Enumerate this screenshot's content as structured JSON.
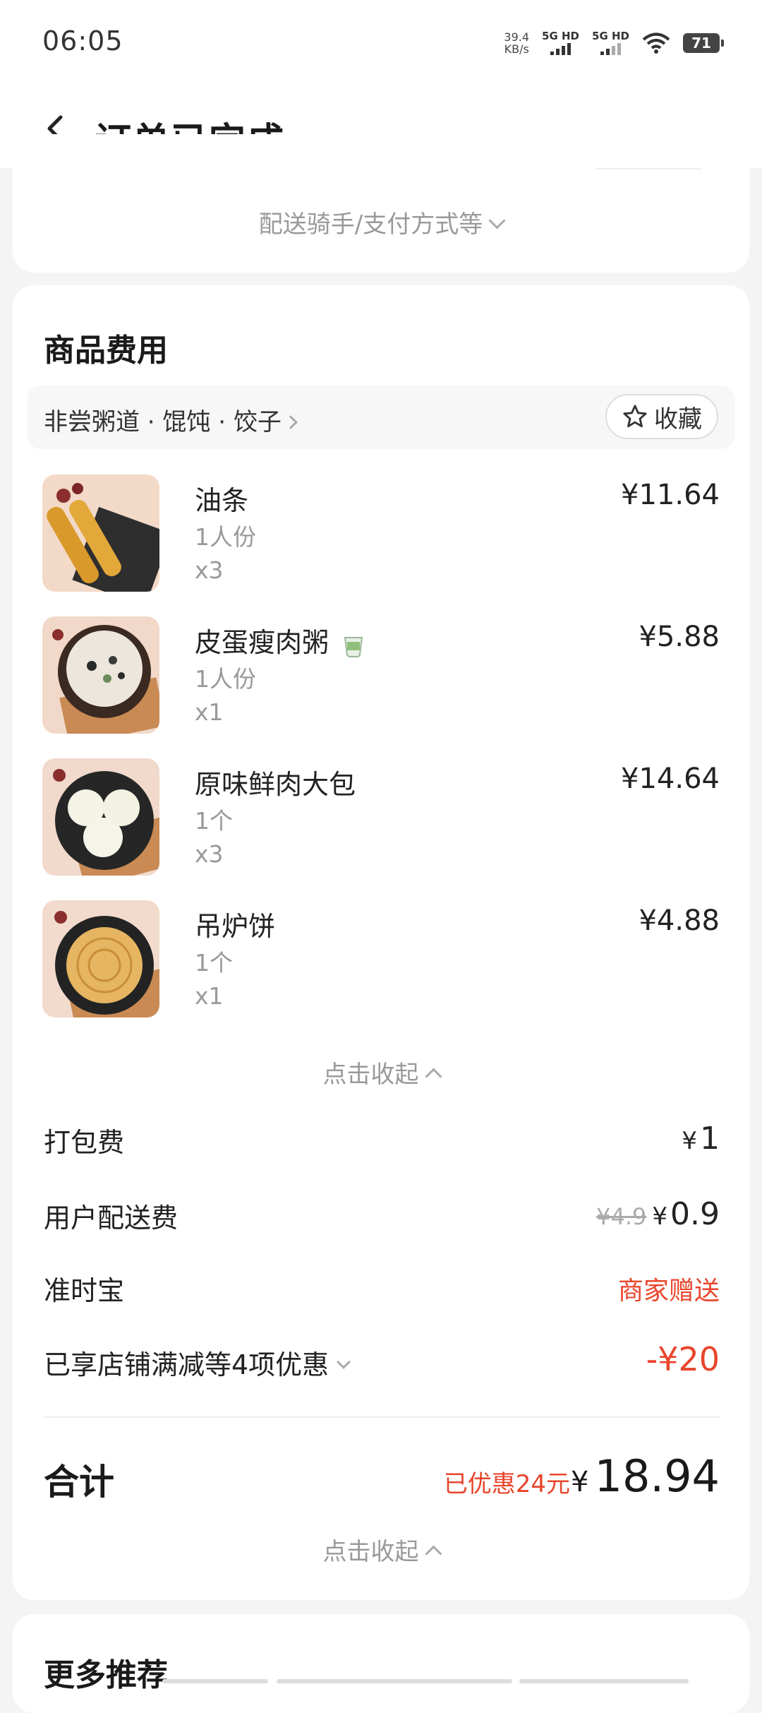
{
  "status_bar": {
    "time": "06:05",
    "net_speed_value": "39.4",
    "net_speed_unit": "KB/s",
    "sim1_label": "5G HD",
    "sim2_label": "5G HD",
    "battery": "71"
  },
  "header": {
    "title": "订单已完成"
  },
  "top_card": {
    "toggle_label": "配送骑手/支付方式等"
  },
  "goods": {
    "section_title": "商品费用",
    "store_name": "非尝粥道 · 馄饨 · 饺子",
    "favorite_label": "收藏",
    "items": [
      {
        "name": "油条",
        "spec": "1人份",
        "qty": "x3",
        "price": "¥11.64"
      },
      {
        "name": "皮蛋瘦肉粥",
        "spec": "1人份",
        "qty": "x1",
        "price": "¥5.88"
      },
      {
        "name": "原味鲜肉大包",
        "spec": "1个",
        "qty": "x3",
        "price": "¥14.64"
      },
      {
        "name": "吊炉饼",
        "spec": "1个",
        "qty": "x1",
        "price": "¥4.88"
      }
    ],
    "collapse_label": "点击收起"
  },
  "fees": {
    "packing": {
      "label": "打包费",
      "currency": "¥",
      "amount": "1"
    },
    "delivery": {
      "label": "用户配送费",
      "original": "¥4.9",
      "currency": "¥",
      "amount": "0.9"
    },
    "ontime": {
      "label": "准时宝",
      "value": "商家赠送"
    },
    "discount": {
      "label": "已享店铺满减等4项优惠",
      "value": "-¥20"
    }
  },
  "total": {
    "label": "合计",
    "saved": "已优惠24元",
    "currency": "¥",
    "amount": "18.94",
    "collapse_label": "点击收起"
  },
  "more": {
    "title": "更多推荐"
  },
  "colors": {
    "accent_red": "#e8452c",
    "text_dark": "#1a1a1a",
    "text_muted": "#999999"
  }
}
